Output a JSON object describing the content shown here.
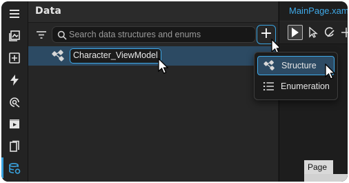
{
  "panel": {
    "title": "Data",
    "search": {
      "placeholder": "Search data structures and enums",
      "value": ""
    },
    "add_button_label": "+",
    "items": [
      {
        "label": "Character_ViewModel",
        "icon": "structure-icon",
        "selected": true
      }
    ]
  },
  "add_menu": {
    "items": [
      {
        "label": "Structure",
        "icon": "structure-icon",
        "highlighted": true
      },
      {
        "label": "Enumeration",
        "icon": "enumeration-icon",
        "highlighted": false
      }
    ]
  },
  "editor": {
    "tab_title": "MainPage.xaml",
    "tools": [
      "select-tool-icon",
      "direct-select-icon",
      "pen-icon",
      "pan-icon"
    ],
    "page_label": "Page"
  },
  "rail": {
    "items": [
      "menu-icon",
      "assets-icon",
      "add-element-icon",
      "interactions-icon",
      "bindings-icon",
      "animations-icon",
      "bookmarks-icon",
      "data-icon"
    ],
    "active": "data-icon"
  },
  "colors": {
    "accent": "#3fa9e8",
    "selection": "#2c4a63",
    "background": "#1e1e1e"
  }
}
